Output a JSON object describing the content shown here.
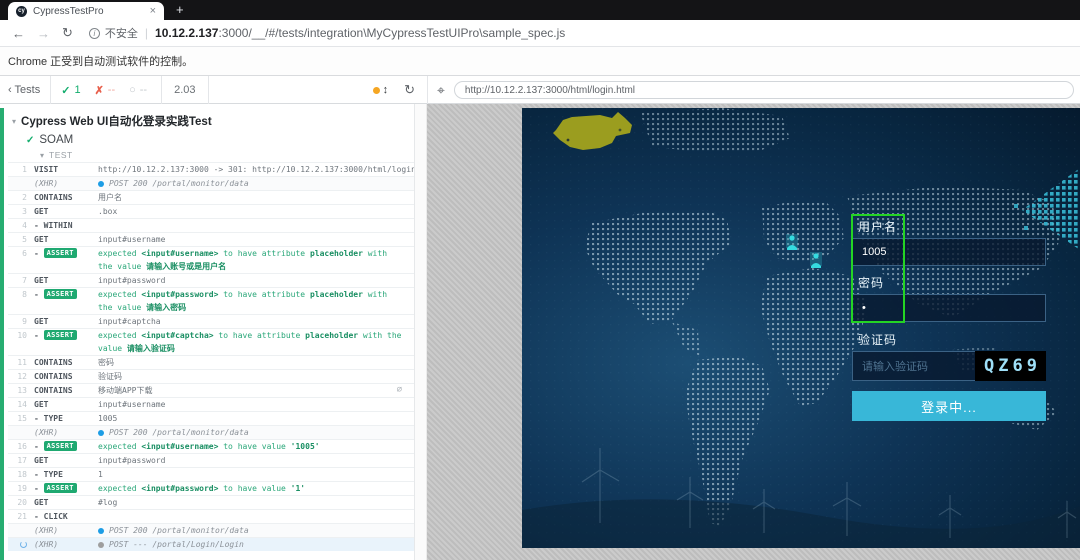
{
  "browser": {
    "tab_title": "CypressTestPro",
    "favicon_text": "cy",
    "close_label": "×",
    "new_tab_label": "+",
    "security_label": "不安全",
    "url_host": "10.12.2.137",
    "url_rest": ":3000/__/#/tests/integration\\MyCypressTestUIPro\\sample_spec.js",
    "infobar_text": "Chrome 正受到自动测试软件的控制。",
    "icons": {
      "back": "←",
      "forward": "→",
      "reload": "↻",
      "info": "i"
    }
  },
  "runner_header": {
    "back_label": "Tests",
    "back_chevron": "‹",
    "passed_icon": "✓",
    "passed_count": "1",
    "failed_icon": "✗",
    "failed_count": "--",
    "pending_icon": "○",
    "pending_count": "--",
    "duration": "2.03",
    "updown_icon": "↕",
    "reload_icon": "↻",
    "selector_icon": "⌖",
    "app_url": "http://10.12.2.137:3000/html/login.html"
  },
  "reporter": {
    "suite_caret": "▾",
    "suite_title": "Cypress Web UI自动化登录实践Test",
    "test_check": "✓",
    "test_name": "SOAM",
    "section_caret": "▾",
    "section_label": "TEST",
    "child_prefix": "-",
    "eye_slash_icon": "∅",
    "xhr_dot_colors": {
      "blue": "#1d9de5",
      "gray": "#9e9e9e"
    },
    "commands": [
      {
        "n": "1",
        "m": "VISIT",
        "msg": [
          {
            "t": "http://10.12.2.137:3000 -> 301: http://10.12.2.137:3000/html/login.h…"
          }
        ]
      },
      {
        "m": "(XHR)",
        "xhr": true,
        "dot": "blue",
        "msg": [
          {
            "t": "POST 200 /portal/monitor/data"
          }
        ]
      },
      {
        "n": "2",
        "m": "CONTAINS",
        "msg": [
          {
            "t": "用户名"
          }
        ]
      },
      {
        "n": "3",
        "m": "GET",
        "msg": [
          {
            "t": ".box"
          }
        ]
      },
      {
        "n": "4",
        "m": "WITHIN",
        "child": true,
        "msg": []
      },
      {
        "n": "5",
        "m": "GET",
        "msg": [
          {
            "t": "input#username"
          }
        ]
      },
      {
        "n": "6",
        "child": true,
        "badge": "ASSERT",
        "assert": true,
        "msg": [
          {
            "t": "expected "
          },
          {
            "t": "<input#username>",
            "b": 1
          },
          {
            "t": " to have attribute "
          },
          {
            "t": "placeholder",
            "b": 1
          },
          {
            "t": " with the value "
          },
          {
            "t": "请输入账号或是用户名",
            "b": 1
          }
        ]
      },
      {
        "n": "7",
        "m": "GET",
        "msg": [
          {
            "t": "input#password"
          }
        ]
      },
      {
        "n": "8",
        "child": true,
        "badge": "ASSERT",
        "assert": true,
        "msg": [
          {
            "t": "expected "
          },
          {
            "t": "<input#password>",
            "b": 1
          },
          {
            "t": " to have attribute "
          },
          {
            "t": "placeholder",
            "b": 1
          },
          {
            "t": " with the value "
          },
          {
            "t": "请输入密码",
            "b": 1
          }
        ]
      },
      {
        "n": "9",
        "m": "GET",
        "msg": [
          {
            "t": "input#captcha"
          }
        ]
      },
      {
        "n": "10",
        "child": true,
        "badge": "ASSERT",
        "assert": true,
        "msg": [
          {
            "t": "expected "
          },
          {
            "t": "<input#captcha>",
            "b": 1
          },
          {
            "t": " to have attribute "
          },
          {
            "t": "placeholder",
            "b": 1
          },
          {
            "t": " with the value "
          },
          {
            "t": "请输入验证码",
            "b": 1
          }
        ]
      },
      {
        "n": "11",
        "m": "CONTAINS",
        "msg": [
          {
            "t": "密码"
          }
        ]
      },
      {
        "n": "12",
        "m": "CONTAINS",
        "msg": [
          {
            "t": "验证码"
          }
        ]
      },
      {
        "n": "13",
        "m": "CONTAINS",
        "icon": "eye-slash",
        "msg": [
          {
            "t": "移动端APP下载"
          }
        ]
      },
      {
        "n": "14",
        "m": "GET",
        "msg": [
          {
            "t": "input#username"
          }
        ]
      },
      {
        "n": "15",
        "m": "TYPE",
        "child": true,
        "msg": [
          {
            "t": "1005"
          }
        ]
      },
      {
        "m": "(XHR)",
        "xhr": true,
        "dot": "blue",
        "msg": [
          {
            "t": "POST 200 /portal/monitor/data"
          }
        ]
      },
      {
        "n": "16",
        "child": true,
        "badge": "ASSERT",
        "assert": true,
        "msg": [
          {
            "t": "expected "
          },
          {
            "t": "<input#username>",
            "b": 1
          },
          {
            "t": " to have value "
          },
          {
            "t": "'1005'",
            "b": 1
          }
        ]
      },
      {
        "n": "17",
        "m": "GET",
        "msg": [
          {
            "t": "input#password"
          }
        ]
      },
      {
        "n": "18",
        "m": "TYPE",
        "child": true,
        "msg": [
          {
            "t": "1"
          }
        ]
      },
      {
        "n": "19",
        "child": true,
        "badge": "ASSERT",
        "assert": true,
        "msg": [
          {
            "t": "expected "
          },
          {
            "t": "<input#password>",
            "b": 1
          },
          {
            "t": " to have value "
          },
          {
            "t": "'1'",
            "b": 1
          }
        ]
      },
      {
        "n": "20",
        "m": "GET",
        "msg": [
          {
            "t": "#log"
          }
        ]
      },
      {
        "n": "21",
        "m": "CLICK",
        "child": true,
        "msg": []
      },
      {
        "m": "(XHR)",
        "xhr": true,
        "dot": "blue",
        "msg": [
          {
            "t": "POST 200 /portal/monitor/data"
          }
        ]
      },
      {
        "m": "(XHR)",
        "xhr": true,
        "pending": true,
        "spinner": true,
        "dot": "gray",
        "msg": [
          {
            "t": "POST --- /portal/Login/Login"
          }
        ]
      }
    ]
  },
  "app": {
    "username_label": "用户名",
    "username_value": "1005",
    "password_label": "密码",
    "password_value": "•",
    "captcha_label": "验证码",
    "captcha_placeholder": "请输入验证码",
    "captcha_code": "QZ69",
    "login_button": "登录中...",
    "colors": {
      "pass_green": "#13ad6d",
      "fail_red": "#e8604c",
      "assert_badge": "#1fa971",
      "xhr_blue": "#1d9de5",
      "pending_gray": "#9e9e9e",
      "notify_orange": "#f5a623",
      "button_cyan": "#38b7d8",
      "highlight_green": "#24d424",
      "app_bg": "#0e3355",
      "captcha_bg": "#000000",
      "captcha_fg": "#9fe0f8"
    }
  }
}
